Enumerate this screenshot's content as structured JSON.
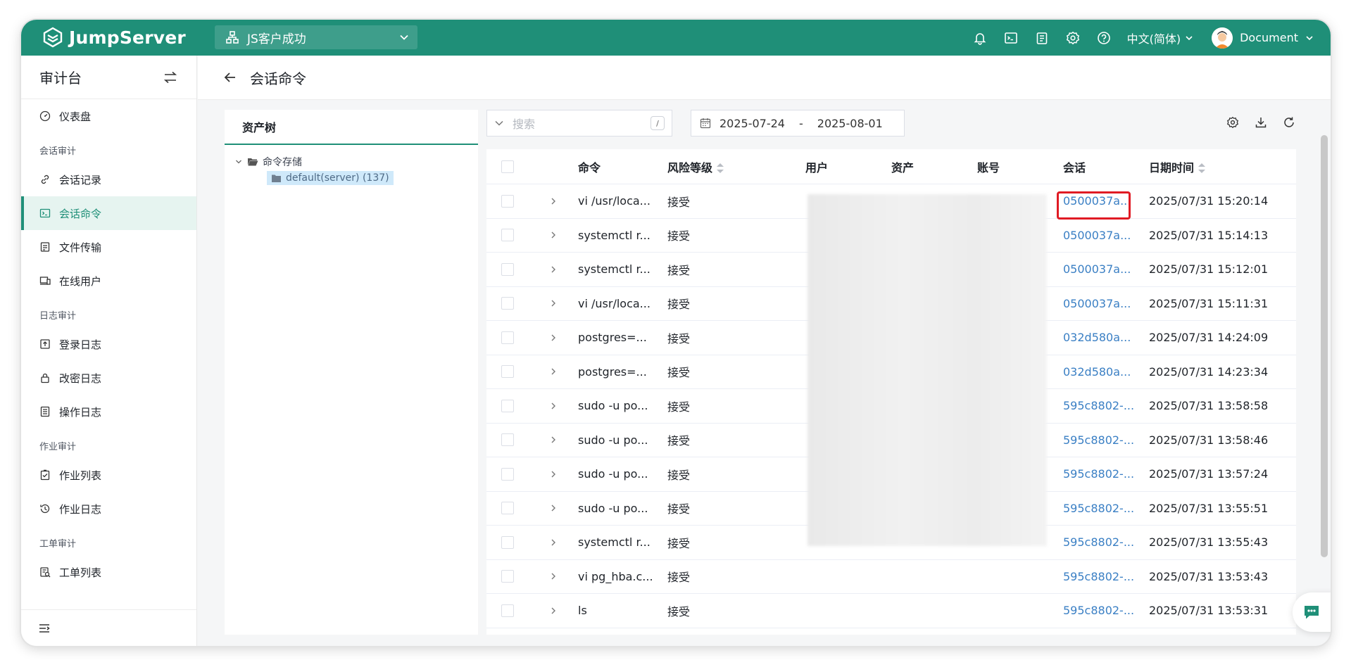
{
  "header": {
    "logo_text": "JumpServer",
    "org": "JS客户成功",
    "lang": "中文(简体)",
    "user": "Document",
    "icons": [
      "bell-icon",
      "terminal-icon",
      "clipboard-icon",
      "gear-icon",
      "help-icon"
    ]
  },
  "sidebar": {
    "title": "审计台",
    "items": [
      {
        "label": "仪表盘",
        "icon": "dashboard-icon"
      },
      {
        "group": "会话审计"
      },
      {
        "label": "会话记录",
        "icon": "link-icon"
      },
      {
        "label": "会话命令",
        "icon": "terminal-icon",
        "active": true
      },
      {
        "label": "文件传输",
        "icon": "file-icon"
      },
      {
        "label": "在线用户",
        "icon": "devices-icon"
      },
      {
        "group": "日志审计"
      },
      {
        "label": "登录日志",
        "icon": "login-icon"
      },
      {
        "label": "改密日志",
        "icon": "lock-icon"
      },
      {
        "label": "操作日志",
        "icon": "doc-icon"
      },
      {
        "group": "作业审计"
      },
      {
        "label": "作业列表",
        "icon": "checklist-icon"
      },
      {
        "label": "作业日志",
        "icon": "history-icon"
      },
      {
        "group": "工单审计"
      },
      {
        "label": "工单列表",
        "icon": "ticket-icon"
      }
    ]
  },
  "page": {
    "title": "会话命令"
  },
  "tree": {
    "tab": "资产树",
    "root": "命令存储",
    "leaf": "default(server) (137)"
  },
  "search": {
    "placeholder": "搜索",
    "shortcut": "/"
  },
  "daterange": {
    "start": "2025-07-24",
    "sep": "-",
    "end": "2025-08-01"
  },
  "table": {
    "headers": {
      "command": "命令",
      "risk": "风险等级",
      "user": "用户",
      "asset": "资产",
      "account": "账号",
      "session": "会话",
      "datetime": "日期时间"
    },
    "rows": [
      {
        "command": "vi /usr/loca...",
        "risk": "接受",
        "session": "0500037a...",
        "datetime": "2025/07/31 15:20:14"
      },
      {
        "command": "systemctl r...",
        "risk": "接受",
        "session": "0500037a...",
        "datetime": "2025/07/31 15:14:13"
      },
      {
        "command": "systemctl r...",
        "risk": "接受",
        "session": "0500037a...",
        "datetime": "2025/07/31 15:12:01"
      },
      {
        "command": "vi /usr/loca...",
        "risk": "接受",
        "session": "0500037a...",
        "datetime": "2025/07/31 15:11:31"
      },
      {
        "command": "postgres=...",
        "risk": "接受",
        "session": "032d580a...",
        "datetime": "2025/07/31 14:24:09"
      },
      {
        "command": "postgres=...",
        "risk": "接受",
        "session": "032d580a...",
        "datetime": "2025/07/31 14:23:34"
      },
      {
        "command": "sudo -u po...",
        "risk": "接受",
        "session": "595c8802-...",
        "datetime": "2025/07/31 13:58:58"
      },
      {
        "command": "sudo -u po...",
        "risk": "接受",
        "session": "595c8802-...",
        "datetime": "2025/07/31 13:58:46"
      },
      {
        "command": "sudo -u po...",
        "risk": "接受",
        "session": "595c8802-...",
        "datetime": "2025/07/31 13:57:24"
      },
      {
        "command": "sudo -u po...",
        "risk": "接受",
        "session": "595c8802-...",
        "datetime": "2025/07/31 13:55:51"
      },
      {
        "command": "systemctl r...",
        "risk": "接受",
        "session": "595c8802-...",
        "datetime": "2025/07/31 13:55:43"
      },
      {
        "command": "vi pg_hba.c...",
        "risk": "接受",
        "session": "595c8802-...",
        "datetime": "2025/07/31 13:53:43"
      },
      {
        "command": "ls",
        "risk": "接受",
        "session": "595c8802-...",
        "datetime": "2025/07/31 13:53:31"
      }
    ]
  },
  "colors": {
    "brand": "#1f8f78",
    "link": "#3a7fc4",
    "highlight": "#e01b24"
  }
}
